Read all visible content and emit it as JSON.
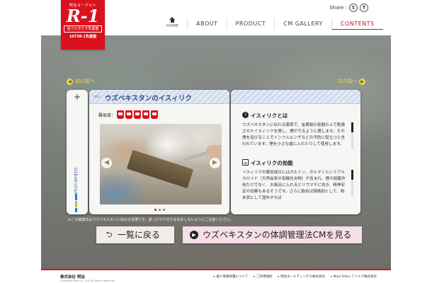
{
  "header": {
    "logo": {
      "subtitle": "明治ヨーグルト",
      "mark": "R-1",
      "tagline": "強さひきだす乳酸菌",
      "strain": "1073R-1乳酸菌"
    },
    "share_label": "Share :",
    "nav": [
      {
        "label": "HOME"
      },
      {
        "label": "ABOUT"
      },
      {
        "label": "PRODUCT"
      },
      {
        "label": "CM GALLERY"
      },
      {
        "label": "CONTENTS"
      }
    ]
  },
  "pager": {
    "prev": "前の国へ",
    "next": "次の国へ"
  },
  "card": {
    "side_label": "Uzbekistan",
    "title_tag": "title",
    "title": "ウズベキスタンのイスィリク",
    "difficulty_label": "難易度：",
    "difficulty_level": 5,
    "sections": [
      {
        "heading": "イスィリクとは",
        "body": "ウズベキスタンに伝わる薬草で、金属製の容器の上で乾燥させたイスィリクを燻し、煙がでるように燻します。その煙を浴びることでインフルエンザなどの予防に役立つと言われています。煙を小さな歯に入れたりして使用します。"
      },
      {
        "heading": "イスィリクの効能",
        "body": "イスィリクの薬効成分にはガルミン、ガルマンというアルカロイド（天然由来の有機化合物）が含まれ、煙の殺菌作用だけでなく、お風呂に入れるとリウマチに効き、精神安定の効果もあるそうです。さらに飲めば頭痛剤として、粉末状にして湿布すれば"
      }
    ]
  },
  "note": "※この健康法はウズベキスタンに伝わる習慣です。誤ったやり方でまねをしないようにご注意ください。",
  "buttons": {
    "back": "一覧に戻る",
    "cm": "ウズベキスタンの体調管理法CMを見る"
  },
  "footer": {
    "company": "株式会社 明治",
    "copyright": "Copyright Meiji Co., Ltd. All Rights Reserved.",
    "links": [
      "個人情報保護について",
      "ご利用規約",
      "明治ホールディングス株式会社",
      "Meiji Seika ファルマ株式会社"
    ]
  }
}
